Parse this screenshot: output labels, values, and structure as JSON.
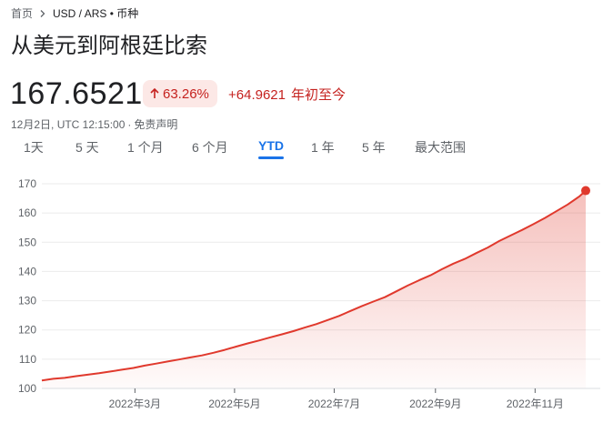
{
  "breadcrumb": {
    "home": "首页",
    "current": "USD / ARS • 币种"
  },
  "title": "从美元到阿根廷比索",
  "quote": {
    "price": "167.6521",
    "change_percent": "63.26%",
    "change_abs": "+64.9621",
    "change_period": "年初至今",
    "timestamp": "12月2日, UTC 12:15:00",
    "disclaimer": "免责声明"
  },
  "colors": {
    "line": "#e0392d",
    "accent": "#1a73e8",
    "negative": "#c5221f"
  },
  "tabs": [
    {
      "label": "1天",
      "active": false
    },
    {
      "label": "5 天",
      "active": false
    },
    {
      "label": "1 个月",
      "active": false
    },
    {
      "label": "6 个月",
      "active": false
    },
    {
      "label": "YTD",
      "active": true
    },
    {
      "label": "1 年",
      "active": false
    },
    {
      "label": "5 年",
      "active": false
    },
    {
      "label": "最大范围",
      "active": false
    }
  ],
  "chart_data": {
    "type": "area",
    "xlabel": "",
    "ylabel": "",
    "ylim": [
      100,
      170
    ],
    "y_ticks": [
      100,
      110,
      120,
      130,
      140,
      150,
      160,
      170
    ],
    "x_ticks": [
      {
        "label": "2022年3月",
        "x": "2022-03-01"
      },
      {
        "label": "2022年5月",
        "x": "2022-05-01"
      },
      {
        "label": "2022年7月",
        "x": "2022-07-01"
      },
      {
        "label": "2022年9月",
        "x": "2022-09-01"
      },
      {
        "label": "2022年11月",
        "x": "2022-11-01"
      }
    ],
    "xlim": [
      "2022-01-03",
      "2022-12-02"
    ],
    "grid": true,
    "series": [
      {
        "points": [
          [
            "2022-01-03",
            102.7
          ],
          [
            "2022-01-10",
            103.3
          ],
          [
            "2022-01-17",
            103.6
          ],
          [
            "2022-01-24",
            104.2
          ],
          [
            "2022-01-31",
            104.7
          ],
          [
            "2022-02-07",
            105.2
          ],
          [
            "2022-02-14",
            105.8
          ],
          [
            "2022-02-21",
            106.4
          ],
          [
            "2022-02-28",
            107.0
          ],
          [
            "2022-03-07",
            107.8
          ],
          [
            "2022-03-14",
            108.5
          ],
          [
            "2022-03-21",
            109.2
          ],
          [
            "2022-03-28",
            109.9
          ],
          [
            "2022-04-04",
            110.6
          ],
          [
            "2022-04-11",
            111.3
          ],
          [
            "2022-04-18",
            112.2
          ],
          [
            "2022-04-25",
            113.2
          ],
          [
            "2022-05-02",
            114.3
          ],
          [
            "2022-05-09",
            115.4
          ],
          [
            "2022-05-16",
            116.4
          ],
          [
            "2022-05-23",
            117.5
          ],
          [
            "2022-05-30",
            118.5
          ],
          [
            "2022-06-06",
            119.6
          ],
          [
            "2022-06-13",
            120.8
          ],
          [
            "2022-06-20",
            122.0
          ],
          [
            "2022-06-27",
            123.4
          ],
          [
            "2022-07-04",
            124.8
          ],
          [
            "2022-07-11",
            126.5
          ],
          [
            "2022-07-18",
            128.2
          ],
          [
            "2022-07-25",
            129.7
          ],
          [
            "2022-08-01",
            131.2
          ],
          [
            "2022-08-08",
            133.2
          ],
          [
            "2022-08-15",
            135.2
          ],
          [
            "2022-08-22",
            137.0
          ],
          [
            "2022-08-29",
            138.7
          ],
          [
            "2022-09-05",
            140.8
          ],
          [
            "2022-09-12",
            142.7
          ],
          [
            "2022-09-19",
            144.3
          ],
          [
            "2022-09-26",
            146.3
          ],
          [
            "2022-10-03",
            148.2
          ],
          [
            "2022-10-10",
            150.4
          ],
          [
            "2022-10-17",
            152.3
          ],
          [
            "2022-10-24",
            154.2
          ],
          [
            "2022-10-31",
            156.2
          ],
          [
            "2022-11-07",
            158.3
          ],
          [
            "2022-11-14",
            160.6
          ],
          [
            "2022-11-21",
            162.9
          ],
          [
            "2022-11-28",
            165.6
          ],
          [
            "2022-12-02",
            167.65
          ]
        ]
      }
    ]
  }
}
